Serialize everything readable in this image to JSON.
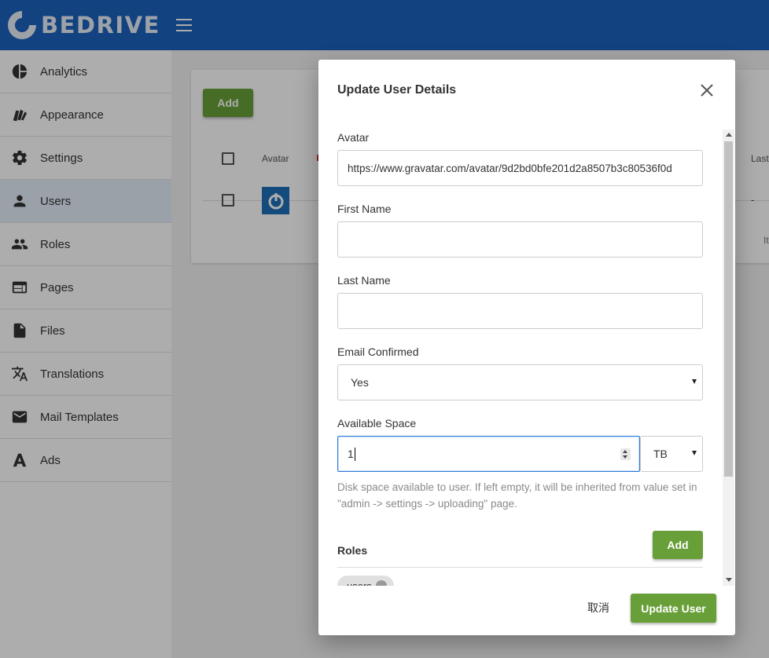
{
  "header": {
    "brand": "BEDRIVE"
  },
  "sidebar": {
    "items": [
      {
        "label": "Analytics",
        "icon": "pie-chart-icon"
      },
      {
        "label": "Appearance",
        "icon": "palette-icon"
      },
      {
        "label": "Settings",
        "icon": "gear-icon"
      },
      {
        "label": "Users",
        "icon": "person-icon",
        "active": true
      },
      {
        "label": "Roles",
        "icon": "people-icon"
      },
      {
        "label": "Pages",
        "icon": "web-page-icon"
      },
      {
        "label": "Files",
        "icon": "file-icon"
      },
      {
        "label": "Translations",
        "icon": "translate-icon"
      },
      {
        "label": "Mail Templates",
        "icon": "mail-icon"
      },
      {
        "label": "Ads",
        "icon": "ads-icon"
      }
    ]
  },
  "users_table": {
    "add_label": "Add",
    "col_avatar": "Avatar",
    "col_last": "Last",
    "row_last_value": "-",
    "footer_text": "It"
  },
  "modal": {
    "title": "Update User Details",
    "avatar_label": "Avatar",
    "avatar_value": "https://www.gravatar.com/avatar/9d2bd0bfe201d2a8507b3c80536f0d",
    "first_name_label": "First Name",
    "first_name_value": "",
    "last_name_label": "Last Name",
    "last_name_value": "",
    "email_confirmed_label": "Email Confirmed",
    "email_confirmed_value": "Yes",
    "available_space_label": "Available Space",
    "available_space_value": "1",
    "space_unit": "TB",
    "hint": "Disk space available to user. If left empty, it will be inherited from value set in \"admin -> settings -> uploading\" page.",
    "roles_label": "Roles",
    "roles_add_label": "Add",
    "role_chip": "users",
    "cancel_label": "取消",
    "update_label": "Update User"
  },
  "colors": {
    "brand": "#1d62bd",
    "accent_green": "#689f38",
    "focus_blue": "#2b7bda"
  }
}
